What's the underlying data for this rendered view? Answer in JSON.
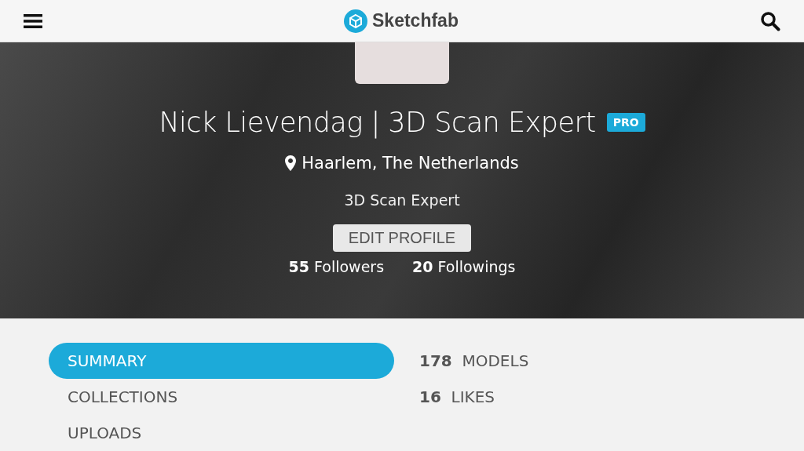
{
  "header": {
    "logo_text": "Sketchfab"
  },
  "profile": {
    "name": "Nick Lievendag | 3D Scan Expert",
    "badge": "PRO",
    "location": "Haarlem, The Netherlands",
    "tagline": "3D Scan Expert",
    "edit_button": "EDIT PROFILE",
    "stats": [
      {
        "count": "55",
        "label": "Followers"
      },
      {
        "count": "20",
        "label": "Followings"
      }
    ]
  },
  "tabs": [
    {
      "label": "SUMMARY",
      "selected": true
    },
    {
      "label": "COLLECTIONS",
      "selected": false
    },
    {
      "label": "UPLOADS",
      "selected": false
    }
  ],
  "counts": [
    {
      "count": "178",
      "label": "MODELS"
    },
    {
      "count": "16",
      "label": "LIKES"
    }
  ]
}
